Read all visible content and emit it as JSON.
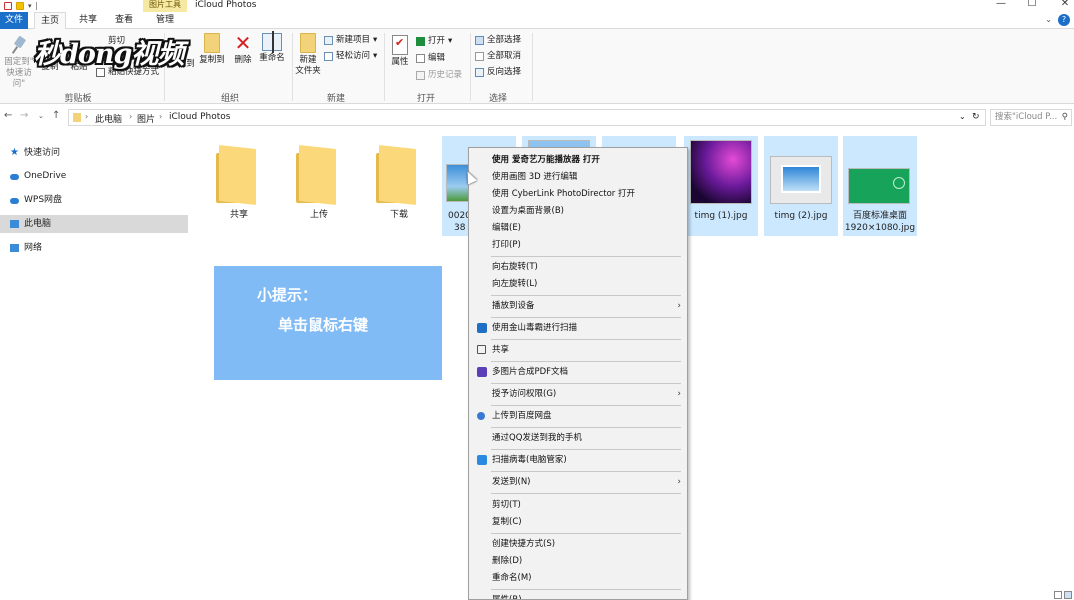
{
  "window": {
    "title": "iCloud Photos",
    "context_tab_header": "图片工具",
    "controls": [
      "—",
      "☐",
      "✕"
    ]
  },
  "ribbon_tabs": [
    "文件",
    "主页",
    "共享",
    "查看",
    "管理"
  ],
  "ribbon": {
    "clipboard": {
      "pin_label_line1": "固定到\"",
      "pin_label_line2": "快速访问\"",
      "copy": "复制",
      "paste": "粘贴",
      "cut": "剪切",
      "paste_shortcut": "粘贴快捷方式",
      "group": "剪贴板"
    },
    "organize": {
      "move_to": "移动到",
      "copy_to": "复制到",
      "delete": "删除",
      "rename": "重命名",
      "group": "组织"
    },
    "new": {
      "new_folder_line1": "新建",
      "new_folder_line2": "文件夹",
      "new_item": "新建项目",
      "easy_access": "轻松访问",
      "group": "新建"
    },
    "open": {
      "properties": "属性",
      "open": "打开",
      "edit": "编辑",
      "history": "历史记录",
      "group": "打开"
    },
    "select": {
      "select_all": "全部选择",
      "select_none": "全部取消",
      "invert": "反向选择",
      "group": "选择"
    }
  },
  "logo": {
    "text": "秒dong视频"
  },
  "address": {
    "crumbs": [
      "此电脑",
      "图片",
      "iCloud Photos"
    ],
    "search_placeholder": "搜索\"iCloud P..."
  },
  "nav_pane": [
    "快速访问",
    "OneDrive",
    "WPS网盘",
    "此电脑",
    "网络"
  ],
  "files": [
    {
      "name": "共享",
      "kind": "folder"
    },
    {
      "name": "上传",
      "kind": "folder"
    },
    {
      "name": "下载",
      "kind": "folder"
    },
    {
      "name": "0020",
      "name2": "38",
      "kind": "image"
    },
    {
      "name": "",
      "kind": "image"
    },
    {
      "name": "",
      "kind": "image"
    },
    {
      "name": "timg (1).jpg",
      "kind": "image"
    },
    {
      "name": "timg (2).jpg",
      "kind": "image"
    },
    {
      "name": "百度标准桌面",
      "name2": "1920×1080.jpg",
      "kind": "image"
    }
  ],
  "tip": {
    "line1": "小提示：",
    "line2": "单击鼠标右键"
  },
  "context_menu": [
    {
      "label": "使用 爱奇艺万能播放器 打开",
      "bold": true
    },
    {
      "label": "使用画图 3D 进行编辑"
    },
    {
      "label": "使用 CyberLink PhotoDirector 打开"
    },
    {
      "label": "设置为桌面背景(B)"
    },
    {
      "label": "编辑(E)"
    },
    {
      "label": "打印(P)"
    },
    {
      "label": "向右旋转(T)"
    },
    {
      "label": "向左旋转(L)"
    },
    {
      "label": "播放到设备",
      "arrow": true
    },
    {
      "label": "使用金山毒霸进行扫描"
    },
    {
      "label": "共享"
    },
    {
      "label": "多图片合成PDF文档"
    },
    {
      "label": "授予访问权限(G)",
      "arrow": true
    },
    {
      "label": "上传到百度网盘"
    },
    {
      "label": "通过QQ发送到我的手机"
    },
    {
      "label": "扫描病毒(电脑管家)"
    },
    {
      "label": "发送到(N)",
      "arrow": true
    },
    {
      "label": "剪切(T)"
    },
    {
      "label": "复制(C)"
    },
    {
      "label": "创建快捷方式(S)"
    },
    {
      "label": "删除(D)"
    },
    {
      "label": "重命名(M)"
    },
    {
      "label": "属性(R)"
    }
  ],
  "colors": {
    "accent": "#1a6fc9",
    "selection": "#cce8ff",
    "tip_bg": "#80bbf6",
    "menu_bg": "#f2f2f2"
  }
}
